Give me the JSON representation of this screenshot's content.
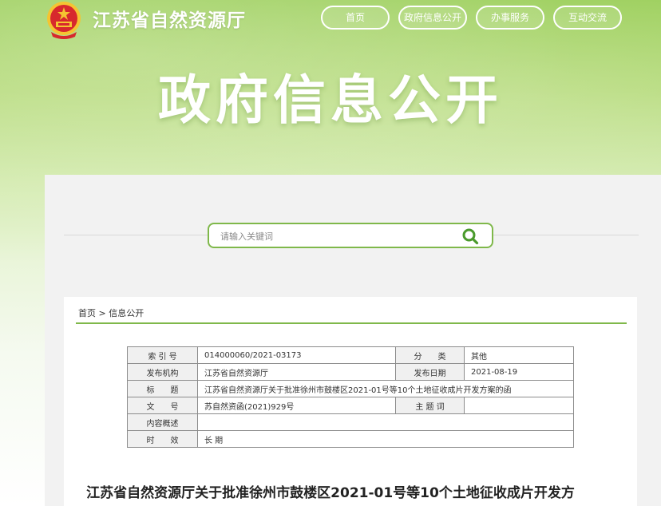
{
  "header": {
    "site_name": "江苏省自然资源厅",
    "nav": [
      {
        "label": "首页"
      },
      {
        "label": "政府信息公开"
      },
      {
        "label": "办事服务"
      },
      {
        "label": "互动交流"
      }
    ]
  },
  "hero": {
    "title": "政府信息公开"
  },
  "search": {
    "placeholder": "请输入关键词"
  },
  "breadcrumb": {
    "home": "首页",
    "separator": " > ",
    "current": "信息公开"
  },
  "meta": {
    "rows": [
      {
        "label": "索 引 号",
        "value": "014000060/2021-03173",
        "label2": "分　　类",
        "value2": "其他"
      },
      {
        "label": "发布机构",
        "value": "江苏省自然资源厅",
        "label2": "发布日期",
        "value2": "2021-08-19"
      },
      {
        "label": "标　　题",
        "value": "江苏省自然资源厅关于批准徐州市鼓楼区2021-01号等10个土地征收成片开发方案的函"
      },
      {
        "label": "文　　号",
        "value": "苏自然资函(2021)929号",
        "label2": "主 题 词",
        "value2": ""
      },
      {
        "label": "内容概述",
        "value": ""
      },
      {
        "label": "时　　效",
        "value": "长 期"
      }
    ]
  },
  "article": {
    "title": "江苏省自然资源厅关于批准徐州市鼓楼区2021-01号等10个土地征收成片开发方"
  },
  "colors": {
    "accent": "#7fb84a",
    "banner": "#9ccf5b",
    "emblem_red": "#d7282d",
    "emblem_gold": "#f5c431"
  }
}
